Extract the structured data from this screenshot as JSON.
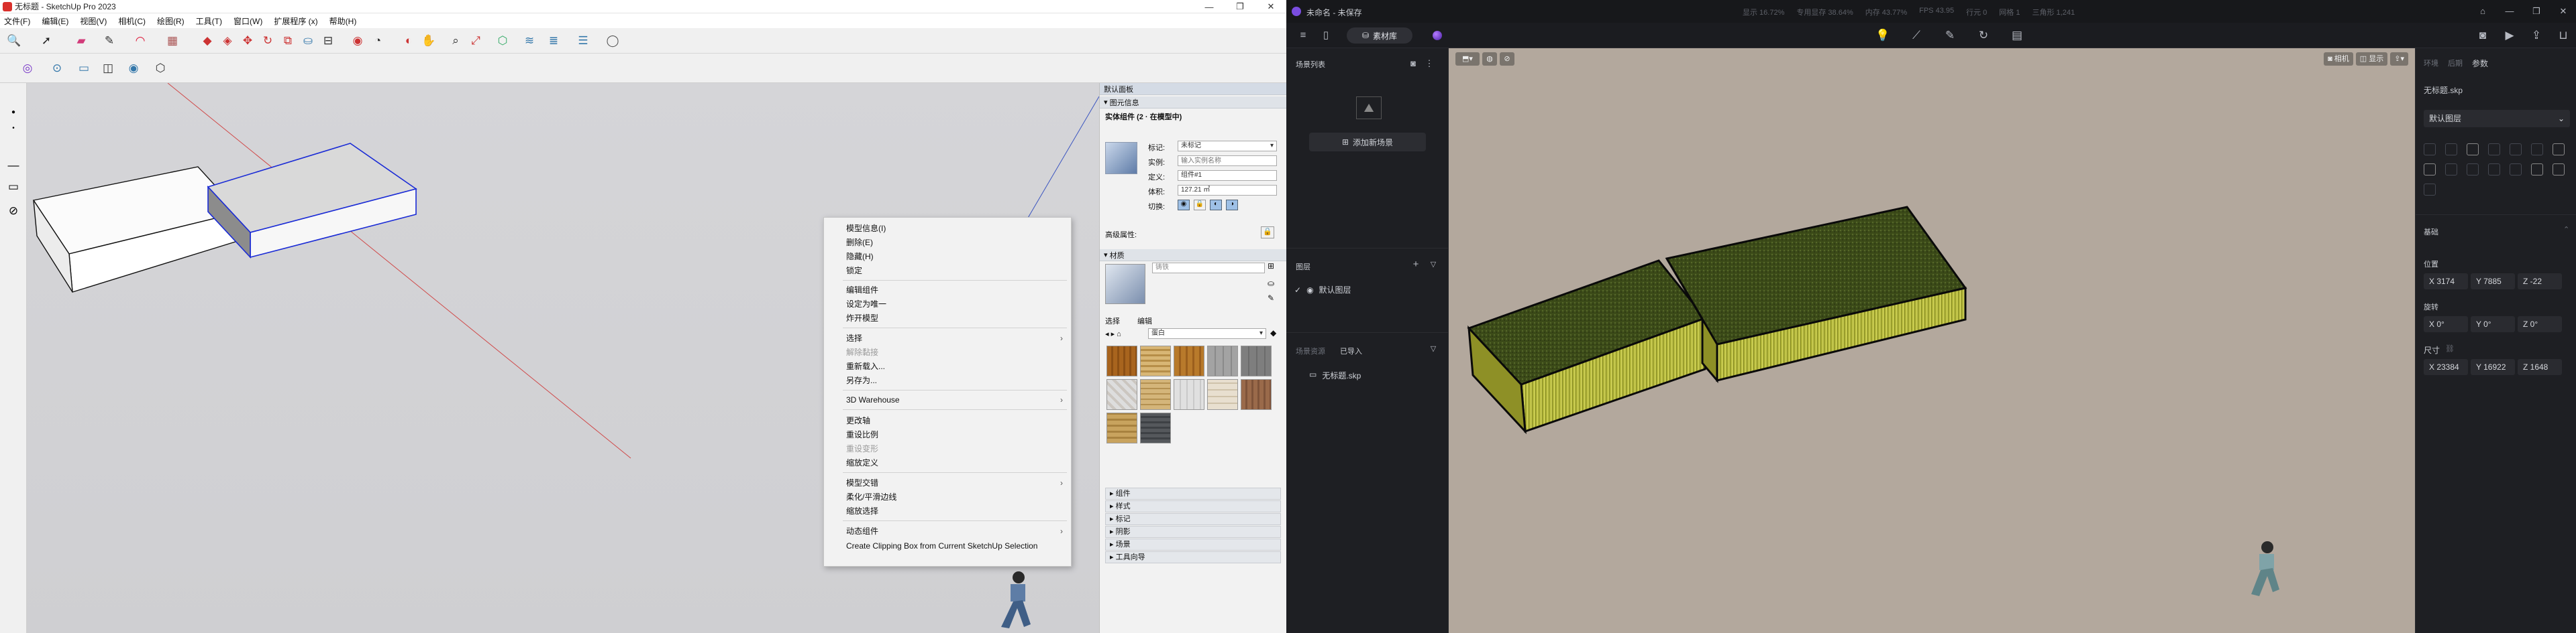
{
  "sketchup": {
    "window_title": "无标题 - SketchUp Pro 2023",
    "window_controls": [
      "—",
      "❐",
      "✕"
    ],
    "menu": [
      "文件(F)",
      "编辑(E)",
      "视图(V)",
      "相机(C)",
      "绘图(R)",
      "工具(T)",
      "窗口(W)",
      "扩展程序 (x)",
      "帮助(H)"
    ],
    "panel": {
      "title": "默认面板",
      "section_entity": "图元信息",
      "entity_type": "实体组件 (2 · 在模型中)",
      "label_tag": "标记:",
      "tag_value": "未标记",
      "label_instance": "实例:",
      "instance_placeholder": "输入实例名称",
      "label_definition": "定义:",
      "definition_value": "组件#1",
      "label_volume": "体积:",
      "volume_value": "127.21 ㎥",
      "label_toggles": "切换:",
      "advanced_attributes": "高级属性:",
      "section_materials": "材质",
      "material_name": "铸铁",
      "tab_select": "选择",
      "tab_edit": "编辑",
      "library_value": "蛋白",
      "collapsed_sections": [
        "组件",
        "样式",
        "标记",
        "阴影",
        "场景",
        "工具向导"
      ]
    },
    "context_menu": [
      {
        "label": "模型信息(I)",
        "disabled": false,
        "submenu": false
      },
      {
        "label": "删除(E)",
        "disabled": false,
        "submenu": false
      },
      {
        "label": "隐藏(H)",
        "disabled": false,
        "submenu": false
      },
      {
        "label": "锁定",
        "disabled": false,
        "submenu": false
      },
      {
        "label": "编辑组件",
        "disabled": false,
        "submenu": false
      },
      {
        "label": "设定为唯一",
        "disabled": false,
        "submenu": false
      },
      {
        "label": "炸开模型",
        "disabled": false,
        "submenu": false
      },
      {
        "label": "选择",
        "disabled": false,
        "submenu": true
      },
      {
        "label": "解除黏接",
        "disabled": true,
        "submenu": false
      },
      {
        "label": "重新载入...",
        "disabled": false,
        "submenu": false
      },
      {
        "label": "另存为...",
        "disabled": false,
        "submenu": false
      },
      {
        "label": "3D Warehouse",
        "disabled": false,
        "submenu": true
      },
      {
        "label": "更改轴",
        "disabled": false,
        "submenu": false
      },
      {
        "label": "重设比例",
        "disabled": false,
        "submenu": false
      },
      {
        "label": "重设变形",
        "disabled": true,
        "submenu": false
      },
      {
        "label": "缩放定义",
        "disabled": false,
        "submenu": false
      },
      {
        "label": "模型交错",
        "disabled": false,
        "submenu": true
      },
      {
        "label": "柔化/平滑边线",
        "disabled": false,
        "submenu": false
      },
      {
        "label": "缩放选择",
        "disabled": false,
        "submenu": false
      },
      {
        "label": "动态组件",
        "disabled": false,
        "submenu": true
      },
      {
        "label": "Create Clipping Box from Current SketchUp Selection",
        "disabled": false,
        "submenu": false
      }
    ]
  },
  "app": {
    "title": "未命名 - 未保存",
    "stats": [
      "显示 16.72%",
      "专用显存 38.64%",
      "内存 43.77%",
      "FPS 43.95",
      "行元 0",
      "网格 1",
      "三角形 1,241"
    ],
    "library_button": "素材库",
    "scene_list_title": "场景列表",
    "add_scene_button": "添加新场景",
    "layers_title": "图层",
    "default_layer": "默认图层",
    "assets_tab": "场景资源",
    "imported_tab": "已导入",
    "file_item": "无标题.skp",
    "viewport_buttons": [
      "相机",
      "显示"
    ],
    "right_tabs": [
      "环境",
      "后期",
      "参数"
    ],
    "file_name": "无标题.skp",
    "layer_select": "默认图层",
    "base_title": "基础",
    "position_label": "位置",
    "position": [
      "X 3174",
      "Y 7885",
      "Z -22"
    ],
    "rotation_label": "旋转",
    "rotation": [
      "X 0°",
      "Y 0°",
      "Z 0°"
    ],
    "size_label": "尺寸",
    "size": [
      "X 23384",
      "Y 16922",
      "Z 1648"
    ]
  },
  "colors": {
    "selection_blue": "#1a2bd6",
    "grass_top": "#3d4d1a",
    "grass_side": "#b5bb3a",
    "app_bg": "#1d1e22",
    "app_viewport": "#b3a89d",
    "sketchup_red": "#d9302c"
  }
}
